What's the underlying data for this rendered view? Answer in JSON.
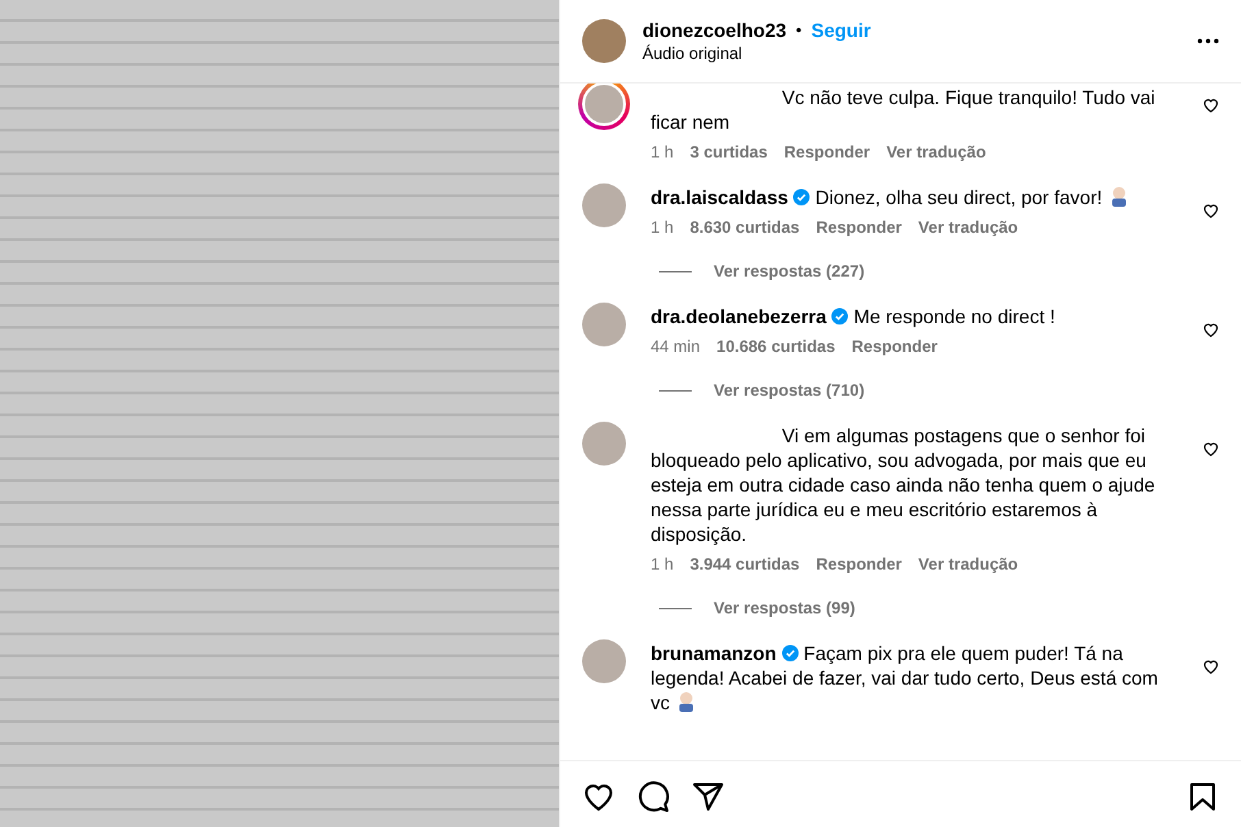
{
  "post": {
    "username": "dionezcoelho23",
    "separator": "•",
    "follow": "Seguir",
    "audio": "Áudio original"
  },
  "comments": [
    {
      "verified": false,
      "story_ring": true,
      "text": "Vc não teve culpa. Fique tranquilo! Tudo vai ficar nem",
      "trailing_emoji": false,
      "time": "1 h",
      "likes": "3 curtidas",
      "reply": "Responder",
      "translate": "Ver tradução"
    },
    {
      "username": "dra.laiscaldass",
      "verified": true,
      "story_ring": false,
      "text": "Dionez, olha seu direct, por favor!",
      "trailing_emoji": true,
      "time": "1 h",
      "likes": "8.630 curtidas",
      "reply": "Responder",
      "translate": "Ver tradução",
      "replies": "Ver respostas (227)"
    },
    {
      "username": "dra.deolanebezerra",
      "verified": true,
      "story_ring": false,
      "text": "Me responde no direct !",
      "trailing_emoji": false,
      "time": "44 min",
      "likes": "10.686 curtidas",
      "reply": "Responder",
      "replies": "Ver respostas (710)"
    },
    {
      "verified": false,
      "story_ring": false,
      "text": "Vi em algumas postagens que o senhor foi bloqueado pelo aplicativo, sou advogada, por mais que eu esteja em outra cidade caso ainda não tenha quem o ajude nessa parte jurídica eu e meu escritório estaremos à disposição.",
      "trailing_emoji": false,
      "time": "1 h",
      "likes": "3.944 curtidas",
      "reply": "Responder",
      "translate": "Ver tradução",
      "replies": "Ver respostas (99)"
    },
    {
      "username": "brunamanzon",
      "verified": true,
      "story_ring": false,
      "text": "Façam pix pra ele quem puder! Tá na legenda! Acabei de fazer, vai dar tudo certo, Deus está com vc",
      "trailing_emoji": true
    }
  ]
}
